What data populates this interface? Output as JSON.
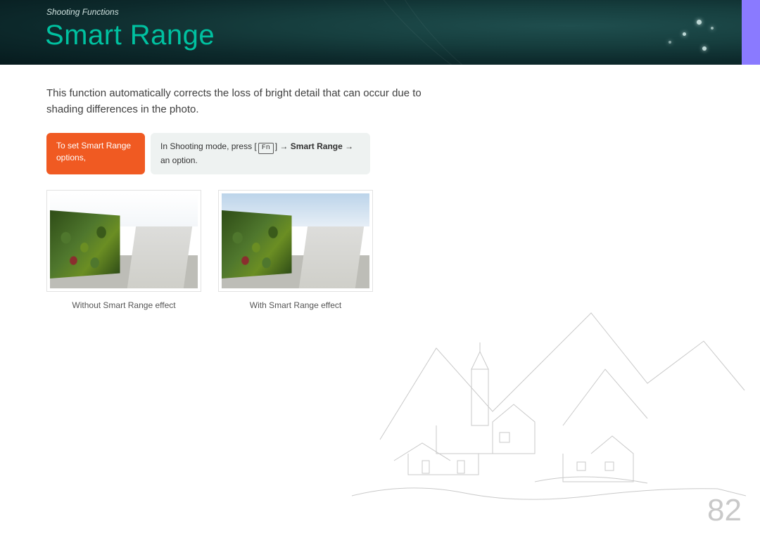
{
  "header": {
    "breadcrumb": "Shooting Functions",
    "title": "Smart Range"
  },
  "intro": "This function automatically corrects the loss of bright detail that can occur due to shading differences in the photo.",
  "callout": {
    "label": "To set Smart Range options,",
    "instruction_prefix": "In Shooting mode, press [",
    "fn_key": "Fn",
    "instruction_mid": "] → ",
    "instruction_strong": "Smart Range",
    "instruction_arrow": " → ",
    "instruction_suffix": "an option."
  },
  "samples": {
    "without": {
      "caption": "Without Smart Range effect"
    },
    "with": {
      "caption": "With Smart Range effect"
    }
  },
  "page_number": "82"
}
